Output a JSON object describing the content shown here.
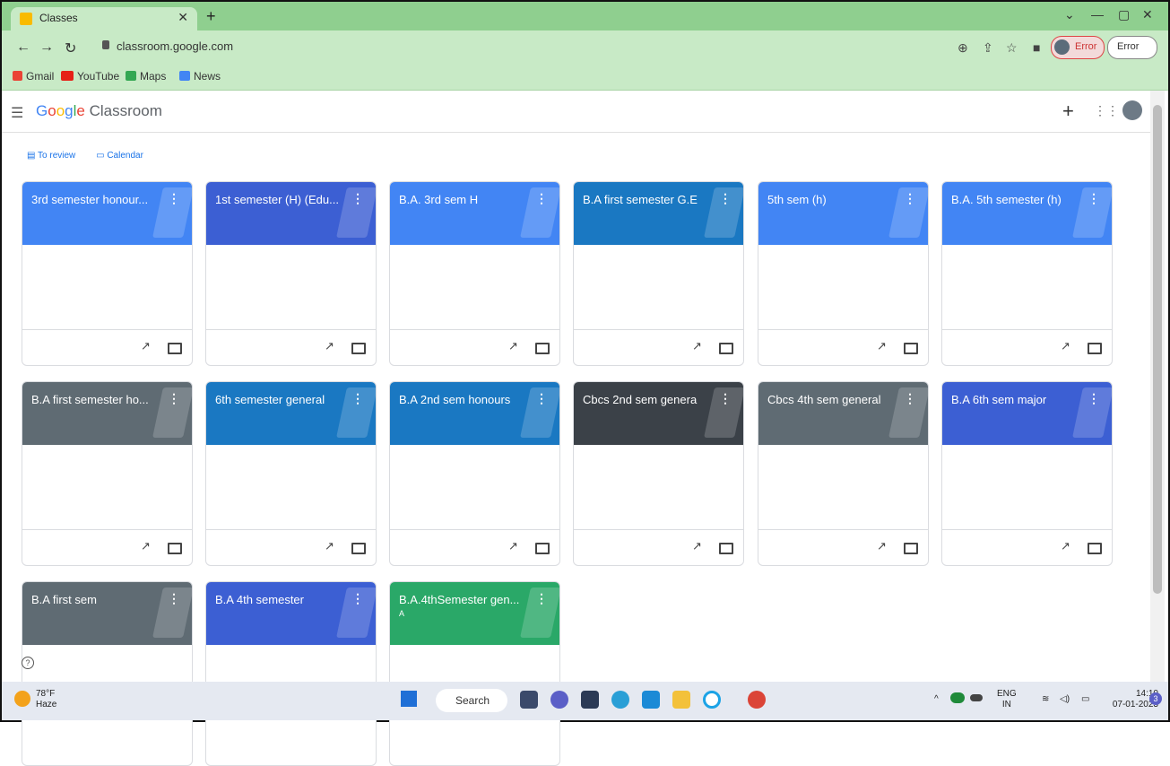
{
  "browser": {
    "tab_title": "Classes",
    "url": "classroom.google.com",
    "profile_error_1": "Error",
    "profile_error_2": "Error",
    "bookmarks": [
      "Gmail",
      "YouTube",
      "Maps",
      "News"
    ]
  },
  "app": {
    "brand_google": [
      "G",
      "o",
      "o",
      "g",
      "l",
      "e"
    ],
    "brand_product": "Classroom",
    "links": [
      "To review",
      "Calendar"
    ]
  },
  "cards": [
    {
      "title": "3rd semester honour...",
      "color": "#4285f4"
    },
    {
      "title": "1st semester (H) (Edu...",
      "color": "#3c5fd3"
    },
    {
      "title": "B.A. 3rd sem H",
      "color": "#4285f4"
    },
    {
      "title": "B.A first semester G.E",
      "color": "#1a78c2"
    },
    {
      "title": "5th sem (h)",
      "color": "#4285f4"
    },
    {
      "title": "B.A. 5th semester (h)",
      "color": "#4285f4"
    },
    {
      "title": "B.A first semester ho...",
      "color": "#5f6b73"
    },
    {
      "title": "6th semester general",
      "color": "#1a78c2"
    },
    {
      "title": "B.A 2nd sem honours",
      "color": "#1a78c2"
    },
    {
      "title": "Cbcs 2nd sem genera",
      "color": "#3b4148"
    },
    {
      "title": "Cbcs 4th sem general",
      "color": "#5f6b73"
    },
    {
      "title": "B.A 6th sem major",
      "color": "#3c5fd3"
    },
    {
      "title": "B.A first sem",
      "color": "#5f6b73"
    },
    {
      "title": "B.A 4th semester",
      "color": "#3c5fd3"
    },
    {
      "title": "B.A.4thSemester gen...",
      "subtitle": "A",
      "color": "#2aa868"
    }
  ],
  "taskbar": {
    "temp": "78°F",
    "condition": "Haze",
    "search": "Search",
    "lang_1": "ENG",
    "lang_2": "IN",
    "time": "14:10",
    "date": "07-01-2023",
    "notif_count": "3"
  }
}
